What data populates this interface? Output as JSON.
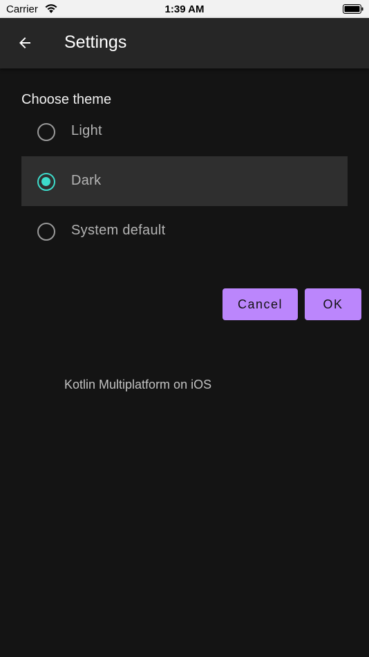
{
  "status_bar": {
    "carrier": "Carrier",
    "time": "1:39 AM",
    "icons": [
      "wifi-icon",
      "battery-icon"
    ]
  },
  "app_bar": {
    "title": "Settings",
    "back_icon": "arrow-left-icon"
  },
  "theme_section": {
    "title": "Choose theme",
    "options": [
      {
        "label": "Light",
        "selected": false
      },
      {
        "label": "Dark",
        "selected": true
      },
      {
        "label": "System default",
        "selected": false
      }
    ]
  },
  "buttons": {
    "cancel_label": "Cancel",
    "ok_label": "OK"
  },
  "footer": {
    "text": "Kotlin Multiplatform on iOS"
  },
  "colors": {
    "accent": "#bb86fc",
    "radio_selected": "#3ddccb",
    "background": "#141414",
    "app_bar": "#262626",
    "selected_row": "#2f2f2f"
  }
}
